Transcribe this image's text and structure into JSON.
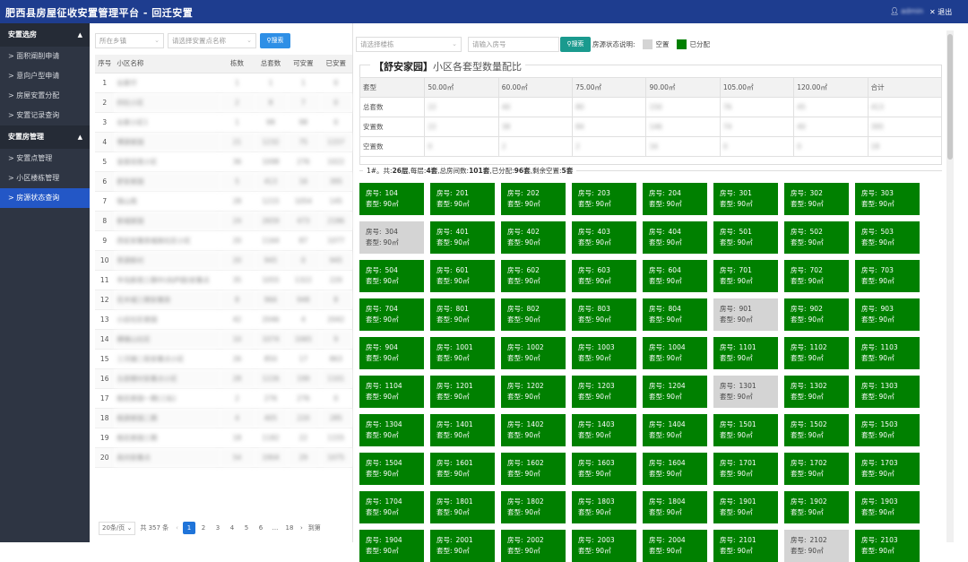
{
  "header": {
    "title": "肥西县房屋征收安置管理平台 - 回迁安置",
    "user": "admin",
    "logout": "退出"
  },
  "sidebar": {
    "groups": [
      {
        "label": "安置选房",
        "items": [
          "> 面积阐削申请",
          "> 意向户型申请",
          "> 房屋安置分配",
          "> 安置记录查询"
        ]
      },
      {
        "label": "安置房管理",
        "items": [
          "> 安置点管理",
          "> 小区楼栋管理",
          "> 房源状态查询"
        ]
      }
    ]
  },
  "filters": {
    "town": "所在乡镇",
    "site": "请选择安置点名称",
    "search": "搜索",
    "building": "请选择楼栋",
    "room_placeholder": "请输入房号",
    "search2": "搜索"
  },
  "legend": {
    "label": "房源状态说明:",
    "vacant": "空置",
    "allocated": "已分配",
    "vacant_color": "#d4d4d4",
    "allocated_color": "#008000"
  },
  "plot_table": {
    "headers": [
      "序号",
      "小区名称",
      "栋数",
      "总套数",
      "可安置",
      "已安置"
    ],
    "rows": [
      [
        "1",
        "谷家圩",
        "1",
        "1",
        "1",
        "0"
      ],
      [
        "2",
        "四社小区",
        "2",
        "8",
        "7",
        "0"
      ],
      [
        "3",
        "谷家小区1",
        "1",
        "98",
        "98",
        "0"
      ],
      [
        "4",
        "博源家园",
        "21",
        "1232",
        "75",
        "1157"
      ],
      [
        "5",
        "宜居佳苑小区",
        "36",
        "1098",
        "276",
        "1022"
      ],
      [
        "6",
        "舒安家园",
        "5",
        "413",
        "16",
        "395"
      ],
      [
        "7",
        "锦山苑",
        "28",
        "1215",
        "1054",
        "145"
      ],
      [
        "8",
        "新城家园",
        "24",
        "2659",
        "473",
        "2186"
      ],
      [
        "9",
        "西宏安置房城南社区小区",
        "20",
        "1164",
        "87",
        "1077"
      ],
      [
        "10",
        "思源新村",
        "20",
        "945",
        "0",
        "945"
      ],
      [
        "11",
        "半岛新苑三期中(尚庐园)安置点",
        "35",
        "1055",
        "1322",
        "220"
      ],
      [
        "12",
        "花木城三期安置房",
        "8",
        "966",
        "948",
        "8"
      ],
      [
        "13",
        "小店社区家园",
        "42",
        "2046",
        "4",
        "2042"
      ],
      [
        "14",
        "横塘山社区",
        "10",
        "1074",
        "1065",
        "9"
      ],
      [
        "15",
        "三河镇二街安置点小区",
        "26",
        "850",
        "17",
        "863"
      ],
      [
        "16",
        "五层楼村安置点小区",
        "28",
        "1226",
        "199",
        "1101"
      ],
      [
        "17",
        "桃花家园一期(三标)",
        "2",
        "276",
        "276",
        "0"
      ],
      [
        "18",
        "桃源家园二期",
        "4",
        "405",
        "220",
        "285"
      ],
      [
        "19",
        "桃花家园三期",
        "18",
        "1182",
        "22",
        "1155"
      ],
      [
        "20",
        "高刘安置点",
        "54",
        "1904",
        "29",
        "1075"
      ]
    ]
  },
  "pager": {
    "size": "20条/页",
    "total": "共 357 条",
    "pages": [
      "1",
      "2",
      "3",
      "4",
      "5",
      "6",
      "...",
      "18"
    ],
    "goto": "到第"
  },
  "mix": {
    "title_name": "【舒安家园】",
    "title_text": "小区各套型数量配比",
    "headers": [
      "套型",
      "50.00㎡",
      "60.00㎡",
      "75.00㎡",
      "90.00㎡",
      "105.00㎡",
      "120.00㎡",
      "合计"
    ],
    "rows": [
      [
        "总套数",
        "22",
        "40",
        "80",
        "150",
        "76",
        "45",
        "413"
      ],
      [
        "安置数",
        "22",
        "38",
        "84",
        "146",
        "74",
        "40",
        "395"
      ],
      [
        "空置数",
        "0",
        "2",
        "2",
        "16",
        "0",
        "0",
        "18"
      ]
    ]
  },
  "building_info": {
    "prefix": "1#。共:",
    "floors": "26层",
    "per_floor_label": ",每层:",
    "per_floor": "4套",
    "total_label": ",总房间数:",
    "total": "101套",
    "alloc_label": ",已分配:",
    "alloc": "96套",
    "vac_label": ",剩余空置:",
    "vac": "5套"
  },
  "room_labels": {
    "no": "房号:",
    "type": "套型:"
  },
  "rooms": [
    {
      "no": "104",
      "size": "90㎡",
      "status": "alloc"
    },
    {
      "no": "201",
      "size": "90㎡",
      "status": "alloc"
    },
    {
      "no": "202",
      "size": "90㎡",
      "status": "alloc"
    },
    {
      "no": "203",
      "size": "90㎡",
      "status": "alloc"
    },
    {
      "no": "204",
      "size": "90㎡",
      "status": "alloc"
    },
    {
      "no": "301",
      "size": "90㎡",
      "status": "alloc"
    },
    {
      "no": "302",
      "size": "90㎡",
      "status": "alloc"
    },
    {
      "no": "303",
      "size": "90㎡",
      "status": "alloc"
    },
    {
      "no": "304",
      "size": "90㎡",
      "status": "vacant"
    },
    {
      "no": "401",
      "size": "90㎡",
      "status": "alloc"
    },
    {
      "no": "402",
      "size": "90㎡",
      "status": "alloc"
    },
    {
      "no": "403",
      "size": "90㎡",
      "status": "alloc"
    },
    {
      "no": "404",
      "size": "90㎡",
      "status": "alloc"
    },
    {
      "no": "501",
      "size": "90㎡",
      "status": "alloc"
    },
    {
      "no": "502",
      "size": "90㎡",
      "status": "alloc"
    },
    {
      "no": "503",
      "size": "90㎡",
      "status": "alloc"
    },
    {
      "no": "504",
      "size": "90㎡",
      "status": "alloc"
    },
    {
      "no": "601",
      "size": "90㎡",
      "status": "alloc"
    },
    {
      "no": "602",
      "size": "90㎡",
      "status": "alloc"
    },
    {
      "no": "603",
      "size": "90㎡",
      "status": "alloc"
    },
    {
      "no": "604",
      "size": "90㎡",
      "status": "alloc"
    },
    {
      "no": "701",
      "size": "90㎡",
      "status": "alloc"
    },
    {
      "no": "702",
      "size": "90㎡",
      "status": "alloc"
    },
    {
      "no": "703",
      "size": "90㎡",
      "status": "alloc"
    },
    {
      "no": "704",
      "size": "90㎡",
      "status": "alloc"
    },
    {
      "no": "801",
      "size": "90㎡",
      "status": "alloc"
    },
    {
      "no": "802",
      "size": "90㎡",
      "status": "alloc"
    },
    {
      "no": "803",
      "size": "90㎡",
      "status": "alloc"
    },
    {
      "no": "804",
      "size": "90㎡",
      "status": "alloc"
    },
    {
      "no": "901",
      "size": "90㎡",
      "status": "vacant"
    },
    {
      "no": "902",
      "size": "90㎡",
      "status": "alloc"
    },
    {
      "no": "903",
      "size": "90㎡",
      "status": "alloc"
    },
    {
      "no": "904",
      "size": "90㎡",
      "status": "alloc"
    },
    {
      "no": "1001",
      "size": "90㎡",
      "status": "alloc"
    },
    {
      "no": "1002",
      "size": "90㎡",
      "status": "alloc"
    },
    {
      "no": "1003",
      "size": "90㎡",
      "status": "alloc"
    },
    {
      "no": "1004",
      "size": "90㎡",
      "status": "alloc"
    },
    {
      "no": "1101",
      "size": "90㎡",
      "status": "alloc"
    },
    {
      "no": "1102",
      "size": "90㎡",
      "status": "alloc"
    },
    {
      "no": "1103",
      "size": "90㎡",
      "status": "alloc"
    },
    {
      "no": "1104",
      "size": "90㎡",
      "status": "alloc"
    },
    {
      "no": "1201",
      "size": "90㎡",
      "status": "alloc"
    },
    {
      "no": "1202",
      "size": "90㎡",
      "status": "alloc"
    },
    {
      "no": "1203",
      "size": "90㎡",
      "status": "alloc"
    },
    {
      "no": "1204",
      "size": "90㎡",
      "status": "alloc"
    },
    {
      "no": "1301",
      "size": "90㎡",
      "status": "vacant"
    },
    {
      "no": "1302",
      "size": "90㎡",
      "status": "alloc"
    },
    {
      "no": "1303",
      "size": "90㎡",
      "status": "alloc"
    },
    {
      "no": "1304",
      "size": "90㎡",
      "status": "alloc"
    },
    {
      "no": "1401",
      "size": "90㎡",
      "status": "alloc"
    },
    {
      "no": "1402",
      "size": "90㎡",
      "status": "alloc"
    },
    {
      "no": "1403",
      "size": "90㎡",
      "status": "alloc"
    },
    {
      "no": "1404",
      "size": "90㎡",
      "status": "alloc"
    },
    {
      "no": "1501",
      "size": "90㎡",
      "status": "alloc"
    },
    {
      "no": "1502",
      "size": "90㎡",
      "status": "alloc"
    },
    {
      "no": "1503",
      "size": "90㎡",
      "status": "alloc"
    },
    {
      "no": "1504",
      "size": "90㎡",
      "status": "alloc"
    },
    {
      "no": "1601",
      "size": "90㎡",
      "status": "alloc"
    },
    {
      "no": "1602",
      "size": "90㎡",
      "status": "alloc"
    },
    {
      "no": "1603",
      "size": "90㎡",
      "status": "alloc"
    },
    {
      "no": "1604",
      "size": "90㎡",
      "status": "alloc"
    },
    {
      "no": "1701",
      "size": "90㎡",
      "status": "alloc"
    },
    {
      "no": "1702",
      "size": "90㎡",
      "status": "alloc"
    },
    {
      "no": "1703",
      "size": "90㎡",
      "status": "alloc"
    },
    {
      "no": "1704",
      "size": "90㎡",
      "status": "alloc"
    },
    {
      "no": "1801",
      "size": "90㎡",
      "status": "alloc"
    },
    {
      "no": "1802",
      "size": "90㎡",
      "status": "alloc"
    },
    {
      "no": "1803",
      "size": "90㎡",
      "status": "alloc"
    },
    {
      "no": "1804",
      "size": "90㎡",
      "status": "alloc"
    },
    {
      "no": "1901",
      "size": "90㎡",
      "status": "alloc"
    },
    {
      "no": "1902",
      "size": "90㎡",
      "status": "alloc"
    },
    {
      "no": "1903",
      "size": "90㎡",
      "status": "alloc"
    },
    {
      "no": "1904",
      "size": "90㎡",
      "status": "alloc"
    },
    {
      "no": "2001",
      "size": "90㎡",
      "status": "alloc"
    },
    {
      "no": "2002",
      "size": "90㎡",
      "status": "alloc"
    },
    {
      "no": "2003",
      "size": "90㎡",
      "status": "alloc"
    },
    {
      "no": "2004",
      "size": "90㎡",
      "status": "alloc"
    },
    {
      "no": "2101",
      "size": "90㎡",
      "status": "alloc"
    },
    {
      "no": "2102",
      "size": "90㎡",
      "status": "vacant"
    },
    {
      "no": "2103",
      "size": "90㎡",
      "status": "alloc"
    }
  ]
}
